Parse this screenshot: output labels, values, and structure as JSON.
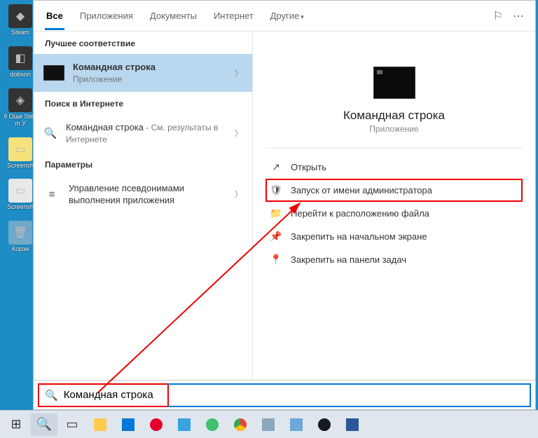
{
  "desktop_icons": [
    {
      "label": "Steam"
    },
    {
      "label": "dobson"
    },
    {
      "label": "9 Оши Steam У"
    },
    {
      "label": "Screensh"
    },
    {
      "label": "Screensh"
    },
    {
      "label": "Корзи"
    }
  ],
  "tabs": {
    "items": [
      "Все",
      "Приложения",
      "Документы",
      "Интернет",
      "Другие"
    ],
    "active_index": 0
  },
  "left": {
    "best_match_header": "Лучшее соответствие",
    "best_match": {
      "title": "Командная строка",
      "sub": "Приложение"
    },
    "web_header": "Поиск в Интернете",
    "web_item": {
      "title": "Командная строка",
      "sub": " - См. результаты в Интернете"
    },
    "settings_header": "Параметры",
    "settings_item": {
      "title": "Управление псевдонимами выполнения приложения"
    }
  },
  "preview": {
    "title": "Командная строка",
    "sub": "Приложение",
    "actions": [
      {
        "icon": "↗",
        "label": "Открыть"
      },
      {
        "icon": "🛡",
        "label": "Запуск от имени администратора"
      },
      {
        "icon": "📁",
        "label": "Перейти к расположению файла"
      },
      {
        "icon": "📌",
        "label": "Закрепить на начальном экране"
      },
      {
        "icon": "📍",
        "label": "Закрепить на панели задач"
      }
    ],
    "highlight_index": 1
  },
  "search_input": {
    "value": "Командная строка"
  },
  "taskbar_icons": [
    "start",
    "search",
    "taskview",
    "explorer",
    "mail",
    "opera",
    "l",
    "360",
    "chrome",
    "settings",
    "skype",
    "steam",
    "word"
  ]
}
